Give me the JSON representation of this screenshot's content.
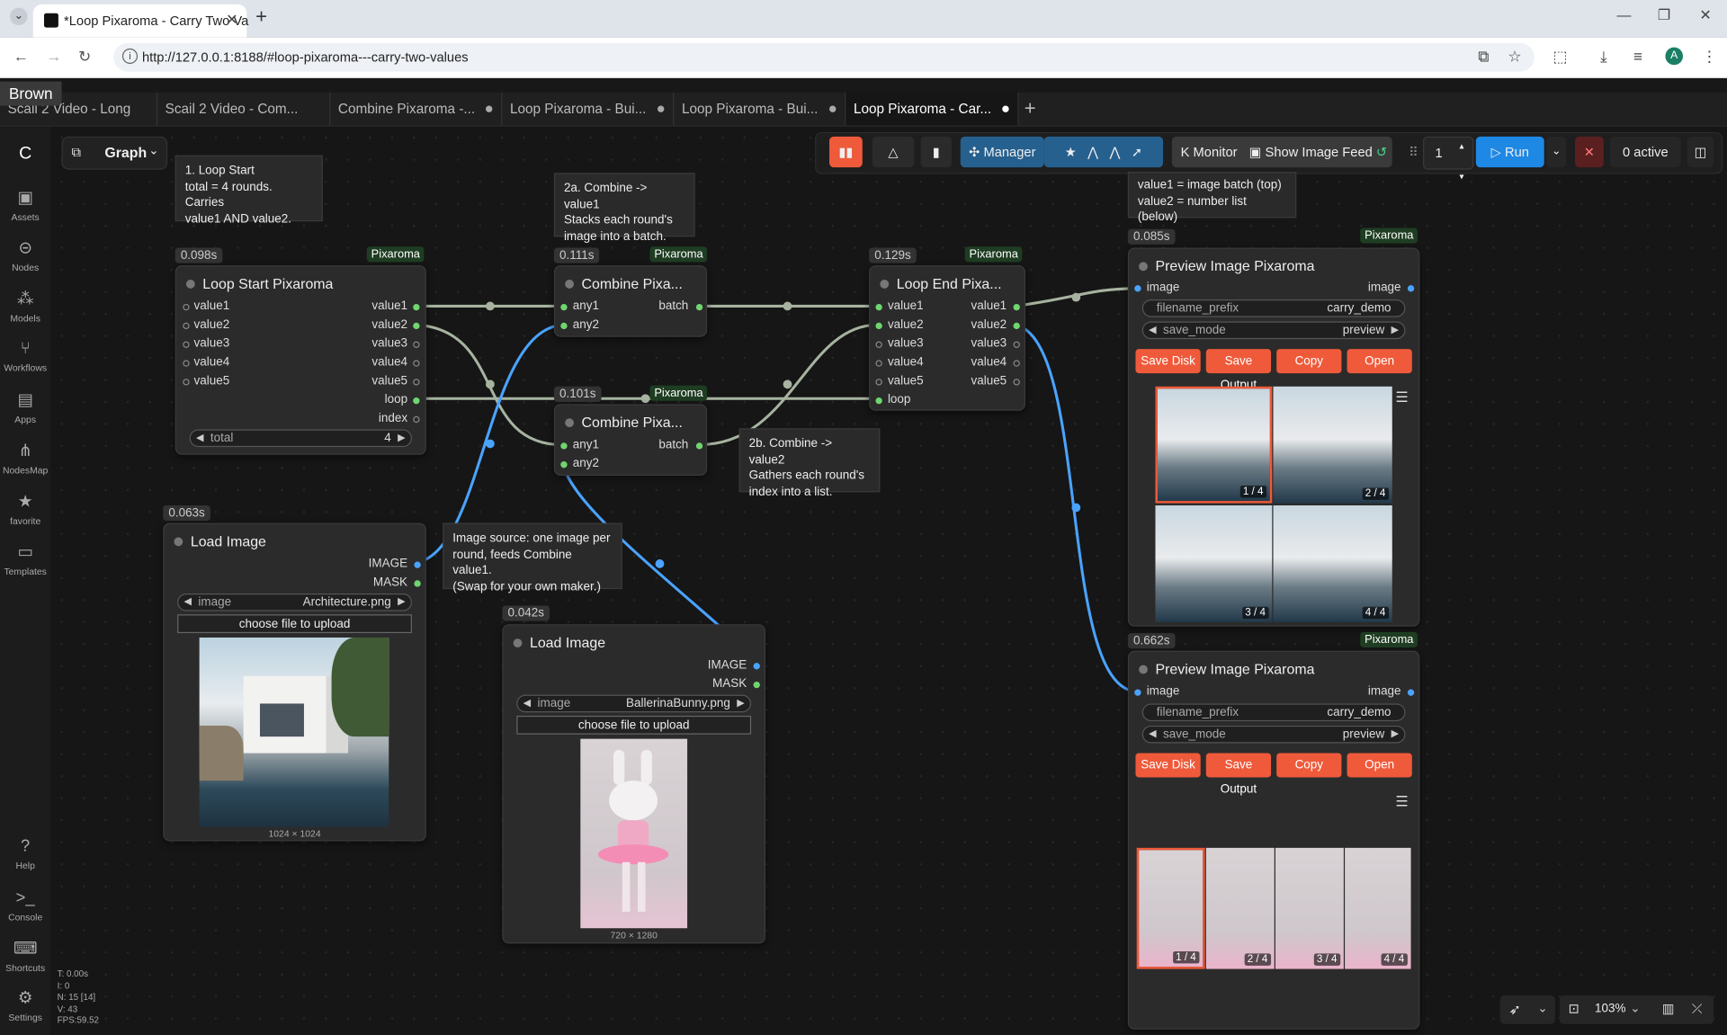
{
  "browser": {
    "tab_title": "*Loop Pixaroma - Carry Two Va",
    "url": "http://127.0.0.1:8188/#loop-pixaroma---carry-two-values",
    "profile_initial": "A"
  },
  "tooltip": "Brown",
  "workflow_tabs": [
    {
      "label": "Scail 2 Video - Long"
    },
    {
      "label": "Scail 2 Video - Com..."
    },
    {
      "label": "Combine Pixaroma -..."
    },
    {
      "label": "Loop Pixaroma - Bui..."
    },
    {
      "label": "Loop Pixaroma - Bui..."
    },
    {
      "label": "Loop Pixaroma - Car..."
    }
  ],
  "sidebar": [
    {
      "label": "Assets",
      "icon": "image-icon"
    },
    {
      "label": "Nodes",
      "icon": "nodes-icon"
    },
    {
      "label": "Models",
      "icon": "models-icon"
    },
    {
      "label": "Workflows",
      "icon": "workflows-icon"
    },
    {
      "label": "Apps",
      "icon": "apps-icon"
    },
    {
      "label": "NodesMap",
      "icon": "nodesmap-icon"
    },
    {
      "label": "favorite",
      "icon": "star-icon"
    },
    {
      "label": "Templates",
      "icon": "templates-icon"
    }
  ],
  "sidebar_bottom": [
    {
      "label": "Help"
    },
    {
      "label": "Console"
    },
    {
      "label": "Shortcuts"
    },
    {
      "label": "Settings"
    }
  ],
  "stats": [
    "T: 0.00s",
    "I: 0",
    "N: 15 [14]",
    "V: 43",
    "FPS:59.52"
  ],
  "graph_button": "Graph",
  "toolbar": {
    "manager": "Manager",
    "monitor": "Monitor",
    "show_image_feed": "Show Image Feed",
    "batch_count": "1",
    "run": "Run",
    "active": "0 active"
  },
  "notes": {
    "loop_start": "1. Loop Start\ntotal = 4 rounds. Carries\nvalue1 AND value2.",
    "combine_a": "2a. Combine -> value1\nStacks each round's\nimage into a batch.",
    "values_info": "value1 = image batch (top)\nvalue2 = number list (below)",
    "combine_b": "2b. Combine -> value2\nGathers each round's\nindex into a list.",
    "image_source": "Image source: one image per\nround, feeds Combine value1.\n(Swap for your own maker.)"
  },
  "nodes": {
    "loop_start": {
      "time": "0.098s",
      "badge": "Pixaroma",
      "title": "Loop Start Pixaroma",
      "inputs": [
        "value1",
        "value2",
        "value3",
        "value4",
        "value5"
      ],
      "outputs": [
        "value1",
        "value2",
        "value3",
        "value4",
        "value5",
        "loop",
        "index"
      ],
      "widget_label": "total",
      "widget_value": "4"
    },
    "combine1": {
      "time": "0.111s",
      "badge": "Pixaroma",
      "title": "Combine Pixa...",
      "inputs": [
        "any1",
        "any2"
      ],
      "output": "batch"
    },
    "combine2": {
      "time": "0.101s",
      "badge": "Pixaroma",
      "title": "Combine Pixa...",
      "inputs": [
        "any1",
        "any2"
      ],
      "output": "batch"
    },
    "loop_end": {
      "time": "0.129s",
      "badge": "Pixaroma",
      "title": "Loop End Pixa...",
      "inputs": [
        "value1",
        "value2",
        "value3",
        "value4",
        "value5",
        "loop"
      ],
      "outputs": [
        "value1",
        "value2",
        "value3",
        "value4",
        "value5"
      ]
    },
    "load_image1": {
      "time": "0.063s",
      "title": "Load Image",
      "outputs": [
        "IMAGE",
        "MASK"
      ],
      "widget_label": "image",
      "widget_value": "Architecture.png",
      "upload": "choose file to upload",
      "dims": "1024 × 1024"
    },
    "load_image2": {
      "time": "0.042s",
      "title": "Load Image",
      "outputs": [
        "IMAGE",
        "MASK"
      ],
      "widget_label": "image",
      "widget_value": "BallerinaBunny.png",
      "upload": "choose file to upload",
      "dims": "720 × 1280"
    },
    "preview1": {
      "time": "0.085s",
      "badge": "Pixaroma",
      "title": "Preview Image Pixaroma",
      "input": "image",
      "output": "image",
      "prefix_label": "filename_prefix",
      "prefix_value": "carry_demo",
      "mode_label": "save_mode",
      "mode_value": "preview",
      "buttons": [
        "Save Disk",
        "Save Output",
        "Copy",
        "Open"
      ],
      "thumbs": [
        "1 / 4",
        "2 / 4",
        "3 / 4",
        "4 / 4"
      ]
    },
    "preview2": {
      "time": "0.662s",
      "badge": "Pixaroma",
      "title": "Preview Image Pixaroma",
      "input": "image",
      "output": "image",
      "prefix_label": "filename_prefix",
      "prefix_value": "carry_demo",
      "mode_label": "save_mode",
      "mode_value": "preview",
      "buttons": [
        "Save Disk",
        "Save Output",
        "Copy",
        "Open"
      ],
      "thumbs": [
        "1 / 4",
        "2 / 4",
        "3 / 4",
        "4 / 4"
      ]
    }
  },
  "zoom": "103%",
  "colors": {
    "accent": "#ef5a3a",
    "link_grey": "#a7b3a0",
    "link_blue": "#4aa3ff",
    "run_blue": "#1e88e5"
  }
}
